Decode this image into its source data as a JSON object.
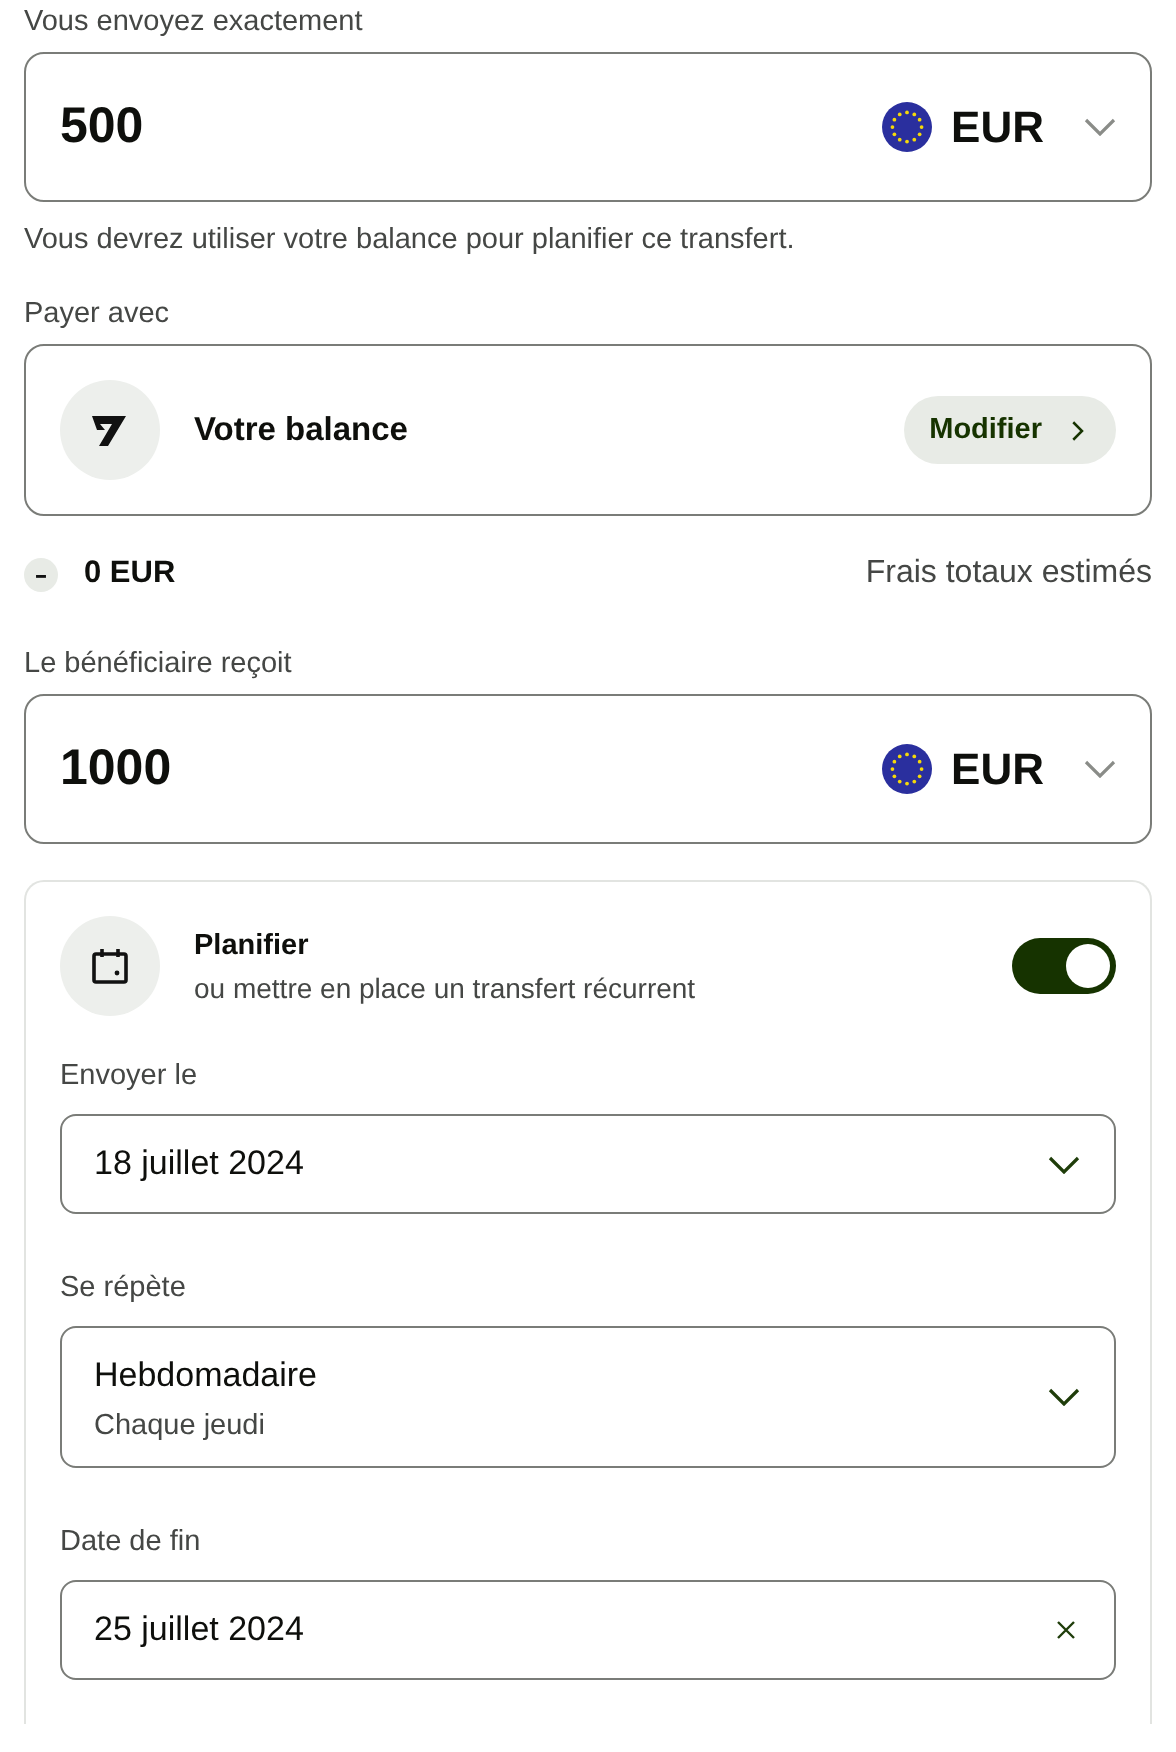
{
  "send": {
    "label": "Vous envoyez exactement",
    "amount": "500",
    "currency": "EUR"
  },
  "note": "Vous devrez utiliser votre balance pour planifier ce transfert.",
  "pay_with": {
    "label": "Payer avec",
    "method": "Votre balance",
    "button": "Modifier"
  },
  "fees": {
    "amount": "0 EUR",
    "label": "Frais totaux estimés"
  },
  "receive": {
    "label": "Le bénéficiaire reçoit",
    "amount": "1000",
    "currency": "EUR"
  },
  "schedule": {
    "title": "Planifier",
    "subtitle": "ou mettre en place un transfert récurrent",
    "on": true,
    "fields": [
      {
        "kind": "select",
        "label": "Envoyer le",
        "value": "18 juillet 2024"
      },
      {
        "kind": "select",
        "label": "Se répète",
        "value": "Hebdomadaire",
        "detail": "Chaque jeudi"
      },
      {
        "kind": "clearable",
        "label": "Date de fin",
        "value": "25 juillet 2024"
      }
    ]
  }
}
